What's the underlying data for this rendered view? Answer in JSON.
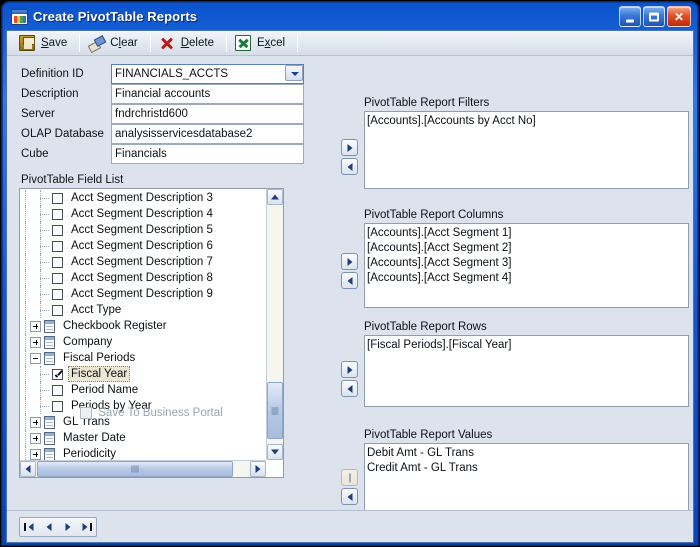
{
  "window": {
    "title": "Create PivotTable Reports",
    "icon": "form-window-icon",
    "minimize_label": "Minimize",
    "maximize_label": "Maximize",
    "close_label": "Close"
  },
  "toolbar": {
    "items": [
      {
        "label": "Save",
        "accel": "S",
        "icon": "save-floppy-icon"
      },
      {
        "label": "Clear",
        "accel": "l",
        "icon": "eraser-icon"
      },
      {
        "label": "Delete",
        "accel": "D",
        "icon": "red-x-icon"
      },
      {
        "label": "Excel",
        "accel": "x",
        "icon": "excel-icon"
      }
    ]
  },
  "form": {
    "fields": [
      {
        "label": "Definition ID",
        "value": "FINANCIALS_ACCTS",
        "control": "lookup"
      },
      {
        "label": "Description",
        "value": "Financial accounts",
        "control": "text"
      },
      {
        "label": "Server",
        "value": "fndrchristd600",
        "control": "text"
      },
      {
        "label": "OLAP Database",
        "value": "analysisservicesdatabase2",
        "control": "text"
      },
      {
        "label": "Cube",
        "value": "Financials",
        "control": "combo"
      }
    ]
  },
  "field_list": {
    "label": "PivotTable Field List",
    "nodes": [
      {
        "text": "Acct Segment Description 3",
        "type": "check",
        "checked": false
      },
      {
        "text": "Acct Segment Description 4",
        "type": "check",
        "checked": false
      },
      {
        "text": "Acct Segment Description 5",
        "type": "check",
        "checked": false
      },
      {
        "text": "Acct Segment Description 6",
        "type": "check",
        "checked": false
      },
      {
        "text": "Acct Segment Description 7",
        "type": "check",
        "checked": false
      },
      {
        "text": "Acct Segment Description 8",
        "type": "check",
        "checked": false
      },
      {
        "text": "Acct Segment Description 9",
        "type": "check",
        "checked": false
      },
      {
        "text": "Acct Type",
        "type": "check",
        "checked": false
      },
      {
        "text": "Checkbook Register",
        "type": "table",
        "expanded": false
      },
      {
        "text": "Company",
        "type": "table",
        "expanded": false
      },
      {
        "text": "Fiscal Periods",
        "type": "table",
        "expanded": true
      },
      {
        "text": "Fiscal Year",
        "type": "check",
        "checked": true,
        "selected": true
      },
      {
        "text": "Period Name",
        "type": "check",
        "checked": false
      },
      {
        "text": "Periods by Year",
        "type": "check",
        "checked": false
      },
      {
        "text": "GL Trans",
        "type": "table",
        "expanded": false
      },
      {
        "text": "Master Date",
        "type": "table",
        "expanded": false
      },
      {
        "text": "Periodicity",
        "type": "table",
        "expanded": false
      }
    ]
  },
  "business_portal": {
    "label": "Save To Business Portal",
    "checked": false,
    "enabled": false
  },
  "panels": [
    {
      "label": "PivotTable Report Filters",
      "items": [
        "[Accounts].[Accounts by Acct No]"
      ],
      "add_enabled": true,
      "remove_enabled": true
    },
    {
      "label": "PivotTable Report Columns",
      "items": [
        "[Accounts].[Acct Segment 1]",
        "[Accounts].[Acct Segment 2]",
        "[Accounts].[Acct Segment 3]",
        "[Accounts].[Acct Segment 4]"
      ],
      "add_enabled": true,
      "remove_enabled": true
    },
    {
      "label": "PivotTable Report Rows",
      "items": [
        "[Fiscal Periods].[Fiscal Year]"
      ],
      "add_enabled": true,
      "remove_enabled": true
    },
    {
      "label": "PivotTable Report Values",
      "items": [
        "Debit Amt - GL Trans",
        "Credit Amt - GL Trans"
      ],
      "add_enabled": false,
      "remove_enabled": true
    }
  ],
  "navigation": {
    "first_label": "First",
    "previous_label": "Previous",
    "next_label": "Next",
    "last_label": "Last"
  }
}
